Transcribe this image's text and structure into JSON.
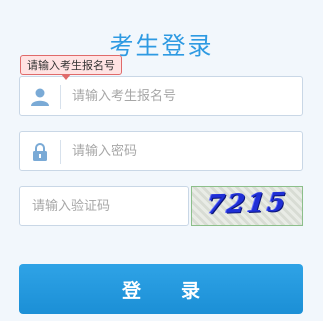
{
  "page": {
    "title": "考生登录"
  },
  "tooltip": {
    "text": "请输入考生报名号"
  },
  "form": {
    "username": {
      "placeholder": "请输入考生报名号",
      "value": "",
      "icon": "user-icon"
    },
    "password": {
      "placeholder": "请输入密码",
      "value": "",
      "icon": "lock-icon"
    },
    "captcha": {
      "placeholder": "请输入验证码",
      "value": "",
      "image_text": "7215"
    },
    "submit_label": "登录"
  },
  "colors": {
    "title": "#2e9ae2",
    "button": "#2196dc",
    "tooltip_border": "#e06a6a",
    "icon": "#7aaad6"
  }
}
